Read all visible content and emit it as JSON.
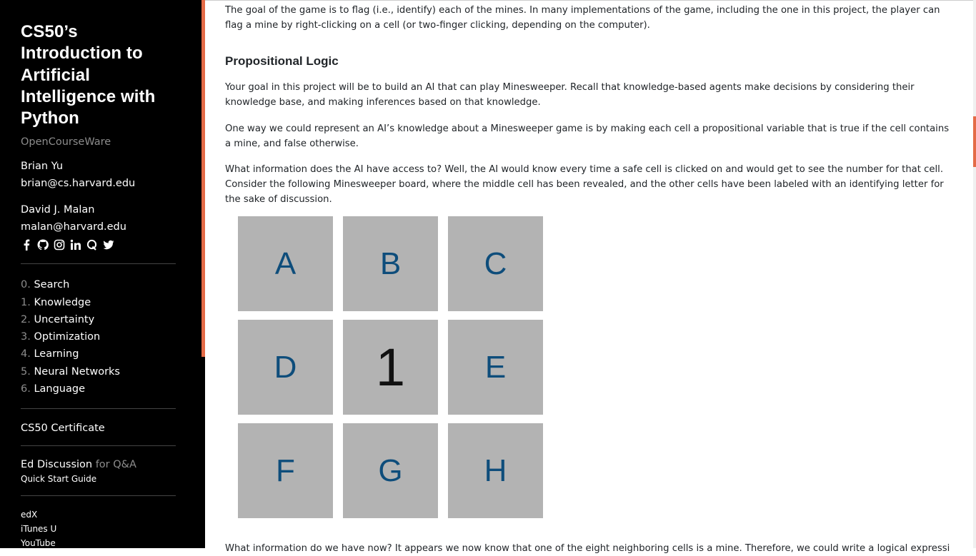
{
  "sidebar": {
    "title": "CS50’s Introduction to Artificial Intelligence with Python",
    "subtitle": "OpenCourseWare",
    "people": [
      {
        "name": "Brian Yu",
        "email": "brian@cs.harvard.edu"
      },
      {
        "name": "David J. Malan",
        "email": "malan@harvard.edu"
      }
    ],
    "social_icons": [
      "facebook-icon",
      "github-icon",
      "instagram-icon",
      "linkedin-icon",
      "quora-icon",
      "twitter-icon"
    ],
    "nav": [
      {
        "num": "0.",
        "label": "Search"
      },
      {
        "num": "1.",
        "label": "Knowledge"
      },
      {
        "num": "2.",
        "label": "Uncertainty"
      },
      {
        "num": "3.",
        "label": "Optimization"
      },
      {
        "num": "4.",
        "label": "Learning"
      },
      {
        "num": "5.",
        "label": "Neural Networks"
      },
      {
        "num": "6.",
        "label": "Language"
      }
    ],
    "certificate": "CS50 Certificate",
    "ed_discussion": "Ed Discussion",
    "ed_for": "for Q&A",
    "quick_start": "Quick Start Guide",
    "links": [
      "edX",
      "iTunes U",
      "YouTube"
    ]
  },
  "main": {
    "p1": "The goal of the game is to flag (i.e., identify) each of the mines. In many implementations of the game, including the one in this project, the player can flag a mine by right-clicking on a cell (or two-finger clicking, depending on the computer).",
    "heading": "Propositional Logic",
    "p2": "Your goal in this project will be to build an AI that can play Minesweeper. Recall that knowledge-based agents make decisions by considering their knowledge base, and making inferences based on that knowledge.",
    "p3": "One way we could represent an AI’s knowledge about a Minesweeper game is by making each cell a propositional variable that is true if the cell contains a mine, and false otherwise.",
    "p4": "What information does the AI have access to? Well, the AI would know every time a safe cell is clicked on and would get to see the number for that cell. Consider the following Minesweeper board, where the middle cell has been revealed, and the other cells have been labeled with an identifying letter for the sake of discussion.",
    "p5": "What information do we have now? It appears we now know that one of the eight neighboring cells is a mine. Therefore, we could write a logical expression like the",
    "board": [
      "A",
      "B",
      "C",
      "D",
      "1",
      "E",
      "F",
      "G",
      "H"
    ]
  },
  "colors": {
    "accent": "#e46b47",
    "cell": "#b3b3b3",
    "letter": "#0e4d7b"
  }
}
